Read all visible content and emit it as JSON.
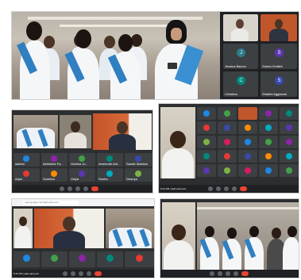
{
  "panels": {
    "top": {
      "tiles": [
        {
          "name": "Jessica Baiono",
          "initial": "J",
          "color": "#2e7d8a"
        },
        {
          "name": "Sneha Vhalkhi",
          "initial": "S",
          "color": "#5e35b1"
        },
        {
          "name": "Christina",
          "initial": "C",
          "color": "#00897b"
        },
        {
          "name": "Shakthi Aggarwal",
          "initial": "S",
          "color": "#3949ab"
        }
      ]
    },
    "middle_left": {
      "tile_names": [
        "aabhin",
        "Abhishek Pa..",
        "Geetha Jo..",
        "Ameenah Adi..",
        "Sarath Mathew",
        "Arjun",
        "Sumitha",
        "Vidya",
        "Sneha",
        "Dhanya"
      ]
    },
    "middle_right": {
      "status": "6:12 PM | aiph-ekcq-vsn"
    },
    "bottom_left": {
      "url": "meet.google.com/aiph-ekcq-vsn",
      "status": "6:11 PM | aiph-ekcq-vsn"
    }
  }
}
